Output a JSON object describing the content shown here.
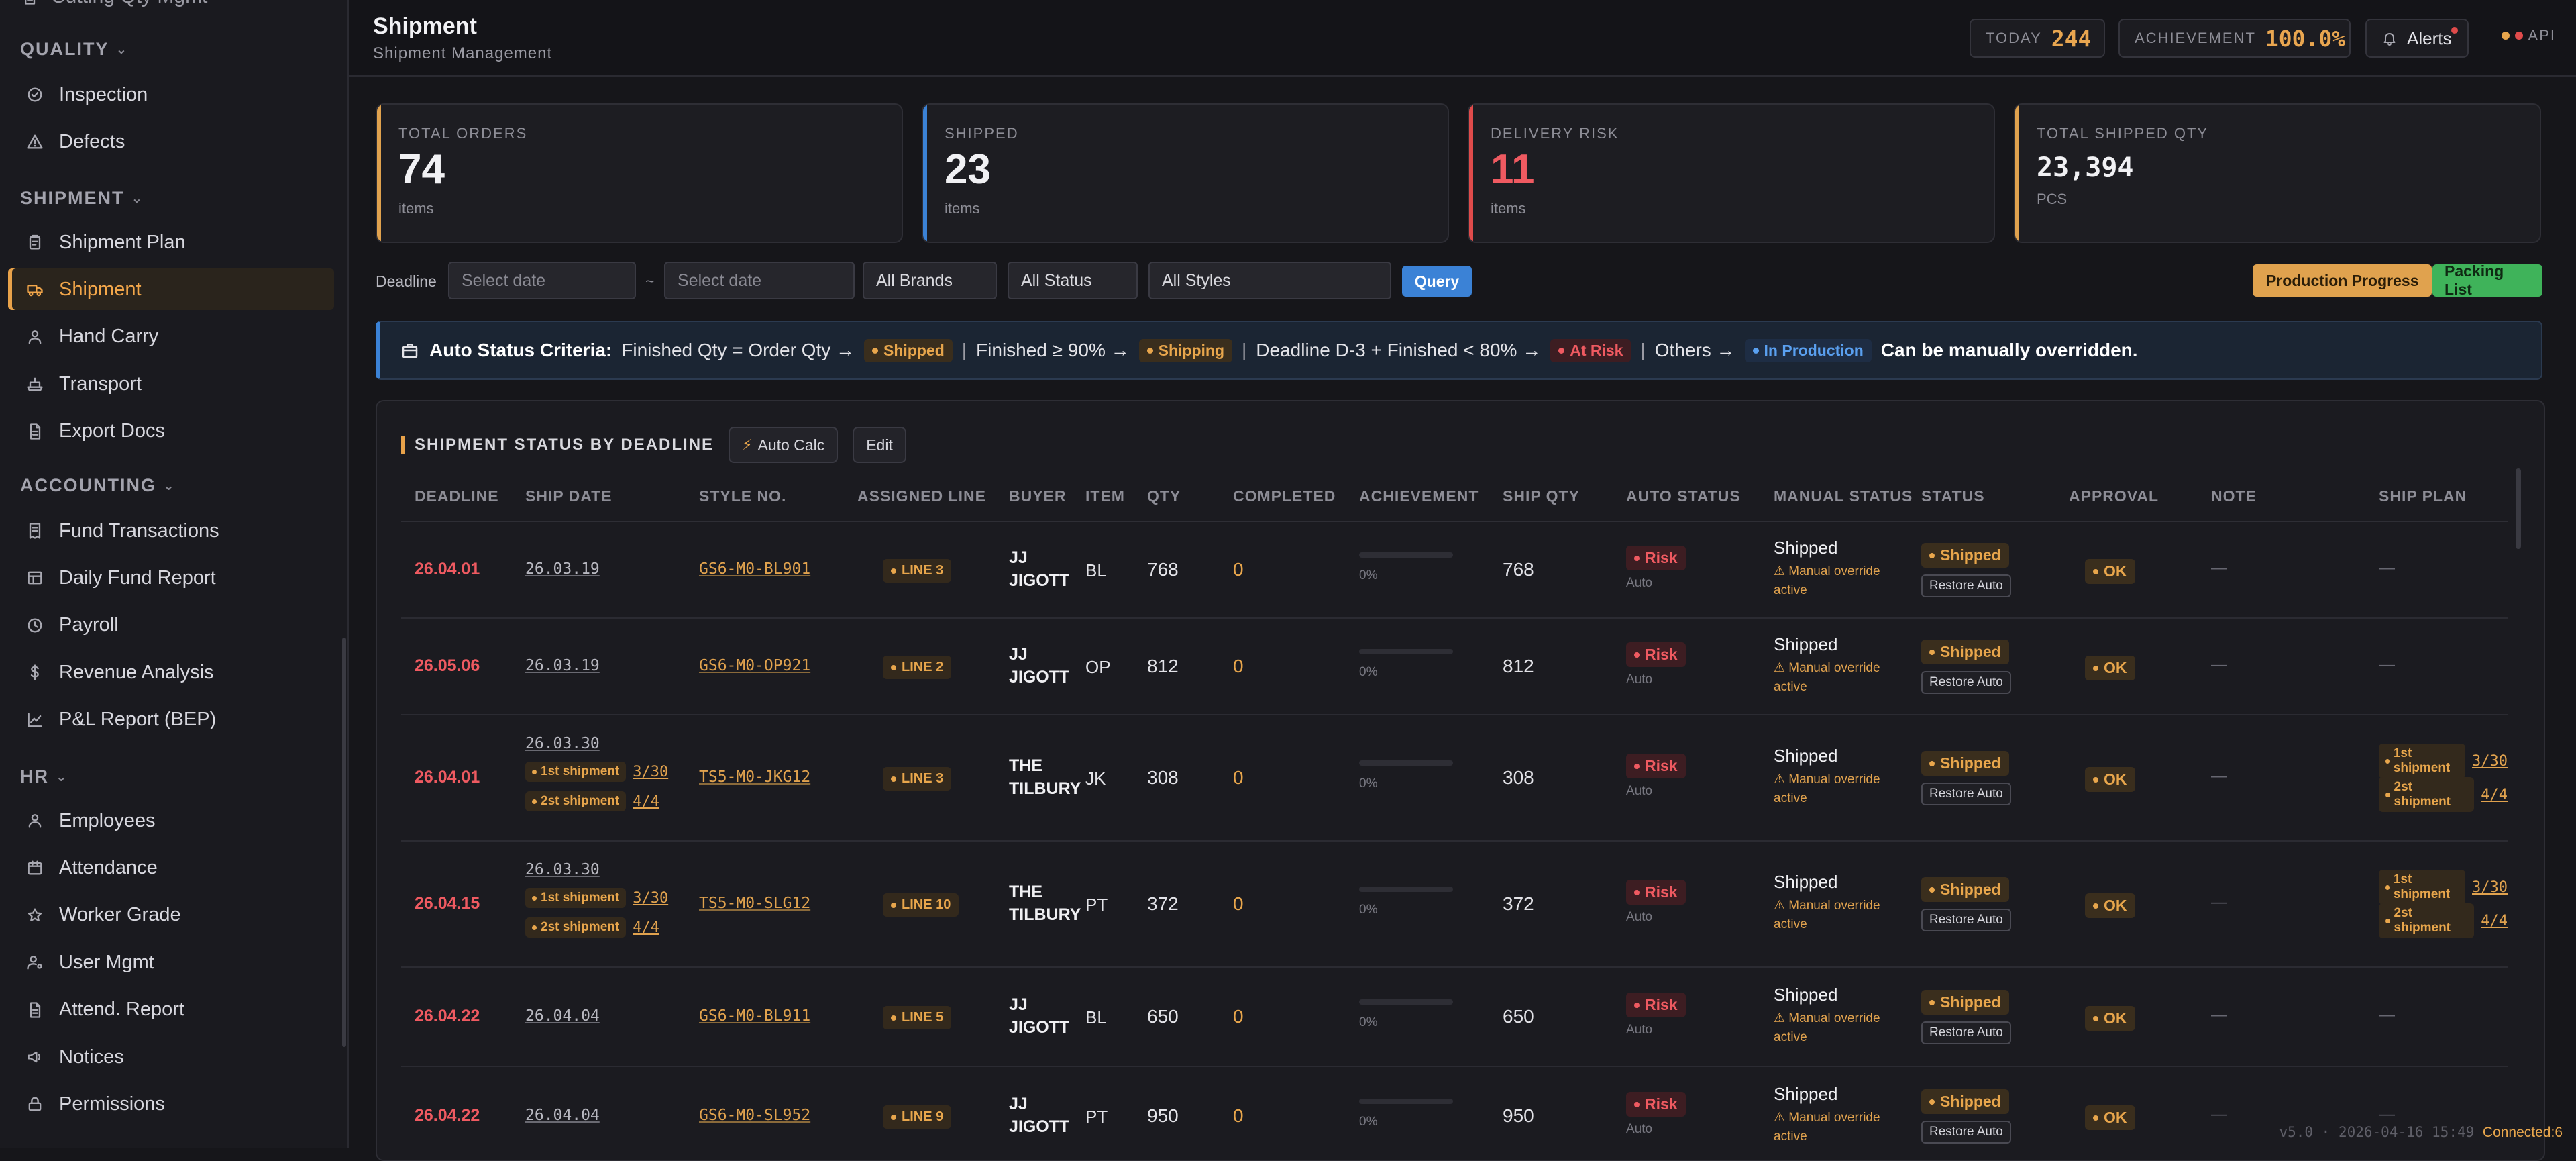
{
  "sidebar": {
    "cut_item": "Cutting Qty Mgmt",
    "sections": [
      {
        "title": "QUALITY",
        "items": [
          {
            "label": "Inspection",
            "icon": "check-circle-icon"
          },
          {
            "label": "Defects",
            "icon": "warning-icon"
          }
        ]
      },
      {
        "title": "SHIPMENT",
        "items": [
          {
            "label": "Shipment Plan",
            "icon": "clipboard-icon"
          },
          {
            "label": "Shipment",
            "icon": "truck-icon",
            "active": true
          },
          {
            "label": "Hand Carry",
            "icon": "person-icon"
          },
          {
            "label": "Transport",
            "icon": "ship-icon"
          },
          {
            "label": "Export Docs",
            "icon": "document-icon"
          }
        ]
      },
      {
        "title": "ACCOUNTING",
        "items": [
          {
            "label": "Fund Transactions",
            "icon": "receipt-icon"
          },
          {
            "label": "Daily Fund Report",
            "icon": "table-icon"
          },
          {
            "label": "Payroll",
            "icon": "clock-icon"
          },
          {
            "label": "Revenue Analysis",
            "icon": "dollar-icon"
          },
          {
            "label": "P&L Report (BEP)",
            "icon": "chart-icon"
          }
        ]
      },
      {
        "title": "HR",
        "items": [
          {
            "label": "Employees",
            "icon": "person-icon"
          },
          {
            "label": "Attendance",
            "icon": "calendar-icon"
          },
          {
            "label": "Worker Grade",
            "icon": "star-icon"
          },
          {
            "label": "User Mgmt",
            "icon": "user-gear-icon"
          },
          {
            "label": "Attend. Report",
            "icon": "document-icon"
          },
          {
            "label": "Notices",
            "icon": "megaphone-icon"
          },
          {
            "label": "Permissions",
            "icon": "lock-icon"
          }
        ]
      }
    ]
  },
  "header": {
    "title": "Shipment",
    "subtitle": "Shipment Management",
    "today_label": "TODAY",
    "today_value": "244",
    "achievement_label": "ACHIEVEMENT",
    "achievement_value": "100.0%",
    "alerts_label": "Alerts",
    "api_label": "API"
  },
  "stats": [
    {
      "title": "TOTAL ORDERS",
      "value": "74",
      "unit": "items",
      "accent": "#e0a24e"
    },
    {
      "title": "SHIPPED",
      "value": "23",
      "unit": "items",
      "accent": "#3b82d6"
    },
    {
      "title": "DELIVERY RISK",
      "value": "11",
      "unit": "items",
      "accent": "#e04b4b"
    },
    {
      "title": "TOTAL SHIPPED QTY",
      "value": "23,394",
      "unit": "PCS",
      "accent": "#e0a24e"
    }
  ],
  "filters": {
    "deadline_label": "Deadline",
    "date_from_placeholder": "Select date",
    "range_sep": "~",
    "date_to_placeholder": "Select date",
    "brand": "All Brands",
    "status": "All Status",
    "style": "All Styles",
    "query_label": "Query",
    "production_progress_label": "Production Progress",
    "packing_list_label": "Packing List"
  },
  "criteria": {
    "title": "Auto Status Criteria:",
    "rule1": "Finished Qty = Order Qty →",
    "pill1": "Shipped",
    "rule2": "Finished ≥ 90% →",
    "pill2": "Shipping",
    "rule3": "Deadline D-3 + Finished < 80% →",
    "pill3": "At Risk",
    "rule4": "Others →",
    "pill4": "In Production",
    "tail": "Can be manually overridden.",
    "sep": "|"
  },
  "panel": {
    "title": "SHIPMENT STATUS BY DEADLINE",
    "auto_calc_label": "Auto Calc",
    "edit_label": "Edit"
  },
  "table": {
    "columns": [
      "DEADLINE",
      "SHIP DATE",
      "STYLE NO.",
      "ASSIGNED LINE",
      "BUYER",
      "ITEM",
      "QTY",
      "COMPLETED",
      "ACHIEVEMENT",
      "SHIP QTY",
      "AUTO STATUS",
      "MANUAL STATUS",
      "STATUS",
      "APPROVAL",
      "NOTE",
      "SHIP PLAN"
    ],
    "rows": [
      {
        "deadline": "26.04.01",
        "ship_date": "26.03.19",
        "ship_parts": [],
        "style": "GS6-M0-BL901",
        "line": "LINE 3",
        "buyer": [
          "JJ",
          "JIGOTT"
        ],
        "item": "BL",
        "qty": "768",
        "completed": "0",
        "achievement": "0%",
        "achievement_value": 0,
        "ship_qty": "768",
        "auto_status": "Risk",
        "auto_label": "Auto",
        "manual_status": "Shipped",
        "override": "⚠ Manual override active",
        "status": "Shipped",
        "restore": "Restore Auto",
        "approval": "OK",
        "note": "—",
        "ship_plan": [],
        "ship_plan_empty": "—"
      },
      {
        "deadline": "26.05.06",
        "ship_date": "26.03.19",
        "ship_parts": [],
        "style": "GS6-M0-OP921",
        "line": "LINE 2",
        "buyer": [
          "JJ",
          "JIGOTT"
        ],
        "item": "OP",
        "qty": "812",
        "completed": "0",
        "achievement": "0%",
        "achievement_value": 0,
        "ship_qty": "812",
        "auto_status": "Risk",
        "auto_label": "Auto",
        "manual_status": "Shipped",
        "override": "⚠ Manual override active",
        "status": "Shipped",
        "restore": "Restore Auto",
        "approval": "OK",
        "note": "—",
        "ship_plan": [],
        "ship_plan_empty": "—"
      },
      {
        "deadline": "26.04.01",
        "ship_date": "26.03.30",
        "ship_parts": [
          {
            "label": "1st shipment",
            "date": "3/30"
          },
          {
            "label": "2st shipment",
            "date": "4/4"
          }
        ],
        "style": "TS5-M0-JKG12",
        "line": "LINE 3",
        "buyer": [
          "THE",
          "TILBURY"
        ],
        "item": "JK",
        "qty": "308",
        "completed": "0",
        "achievement": "0%",
        "achievement_value": 0,
        "ship_qty": "308",
        "auto_status": "Risk",
        "auto_label": "Auto",
        "manual_status": "Shipped",
        "override": "⚠ Manual override active",
        "status": "Shipped",
        "restore": "Restore Auto",
        "approval": "OK",
        "note": "—",
        "ship_plan": [
          {
            "label": "1st shipment",
            "date": "3/30"
          },
          {
            "label": "2st shipment",
            "date": "4/4"
          }
        ],
        "ship_plan_empty": ""
      },
      {
        "deadline": "26.04.15",
        "ship_date": "26.03.30",
        "ship_parts": [
          {
            "label": "1st shipment",
            "date": "3/30"
          },
          {
            "label": "2st shipment",
            "date": "4/4"
          }
        ],
        "style": "TS5-M0-SLG12",
        "line": "LINE 10",
        "buyer": [
          "THE",
          "TILBURY"
        ],
        "item": "PT",
        "qty": "372",
        "completed": "0",
        "achievement": "0%",
        "achievement_value": 0,
        "ship_qty": "372",
        "auto_status": "Risk",
        "auto_label": "Auto",
        "manual_status": "Shipped",
        "override": "⚠ Manual override active",
        "status": "Shipped",
        "restore": "Restore Auto",
        "approval": "OK",
        "note": "—",
        "ship_plan": [
          {
            "label": "1st shipment",
            "date": "3/30"
          },
          {
            "label": "2st shipment",
            "date": "4/4"
          }
        ],
        "ship_plan_empty": ""
      },
      {
        "deadline": "26.04.22",
        "ship_date": "26.04.04",
        "ship_parts": [],
        "style": "GS6-M0-BL911",
        "line": "LINE 5",
        "buyer": [
          "JJ",
          "JIGOTT"
        ],
        "item": "BL",
        "qty": "650",
        "completed": "0",
        "achievement": "0%",
        "achievement_value": 0,
        "ship_qty": "650",
        "auto_status": "Risk",
        "auto_label": "Auto",
        "manual_status": "Shipped",
        "override": "⚠ Manual override active",
        "status": "Shipped",
        "restore": "Restore Auto",
        "approval": "OK",
        "note": "—",
        "ship_plan": [],
        "ship_plan_empty": "—"
      },
      {
        "deadline": "26.04.22",
        "ship_date": "26.04.04",
        "ship_parts": [],
        "style": "GS6-M0-SL952",
        "line": "LINE 9",
        "buyer": [
          "JJ",
          "JIGOTT"
        ],
        "item": "PT",
        "qty": "950",
        "completed": "0",
        "achievement": "0%",
        "achievement_value": 0,
        "ship_qty": "950",
        "auto_status": "Risk",
        "auto_label": "Auto",
        "manual_status": "Shipped",
        "override": "⚠ Manual override active",
        "status": "Shipped",
        "restore": "Restore Auto",
        "approval": "OK",
        "note": "—",
        "ship_plan": [],
        "ship_plan_empty": "—"
      }
    ]
  },
  "footer": {
    "version": "v5.0 · 2026-04-16 15:49",
    "connected": "Connected:6"
  },
  "colors": {
    "accent": "#e0a24e",
    "risk": "#ef5a61",
    "query": "#3b82d6",
    "packing": "#3fb35a"
  }
}
